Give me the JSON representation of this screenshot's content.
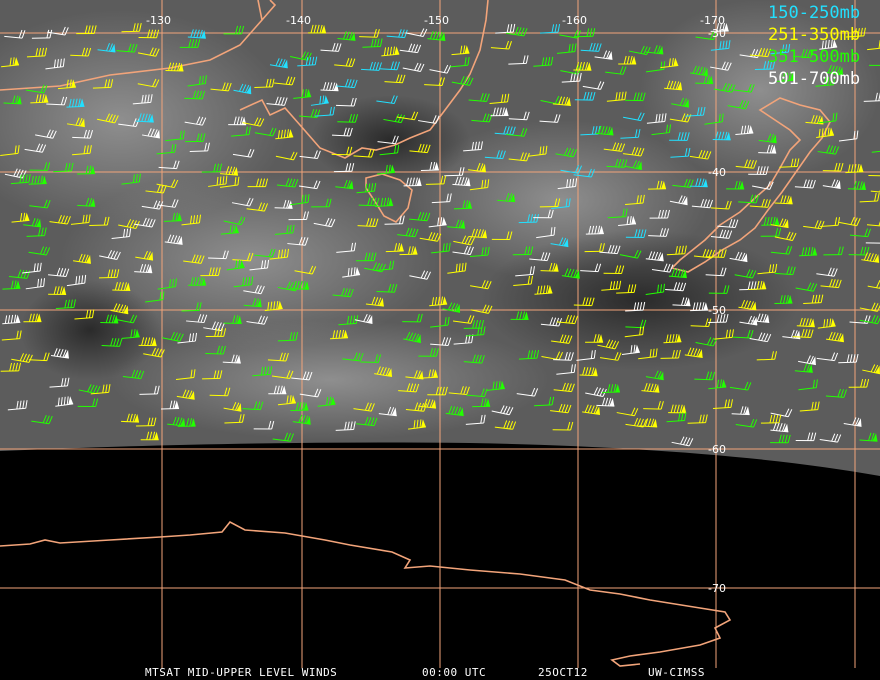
{
  "map": {
    "longitude_labels": [
      "-130",
      "-140",
      "-150",
      "-160",
      "-170"
    ],
    "latitude_labels": [
      "-30",
      "-40",
      "-50",
      "-60",
      "-70"
    ],
    "legend": [
      {
        "label": "150-250mb",
        "color": "#22e0ff"
      },
      {
        "label": "251-350mb",
        "color": "#ffff00"
      },
      {
        "label": "351-500mb",
        "color": "#22ff00"
      },
      {
        "label": "501-700mb",
        "color": "#ffffff"
      }
    ],
    "grid_color": "#f2a47a",
    "coast_color": "#f2a47a"
  },
  "footer": {
    "product": "MTSAT MID-UPPER LEVEL WINDS",
    "time": "00:00 UTC",
    "date": "25OCT12",
    "source": "UW-CIMSS"
  }
}
